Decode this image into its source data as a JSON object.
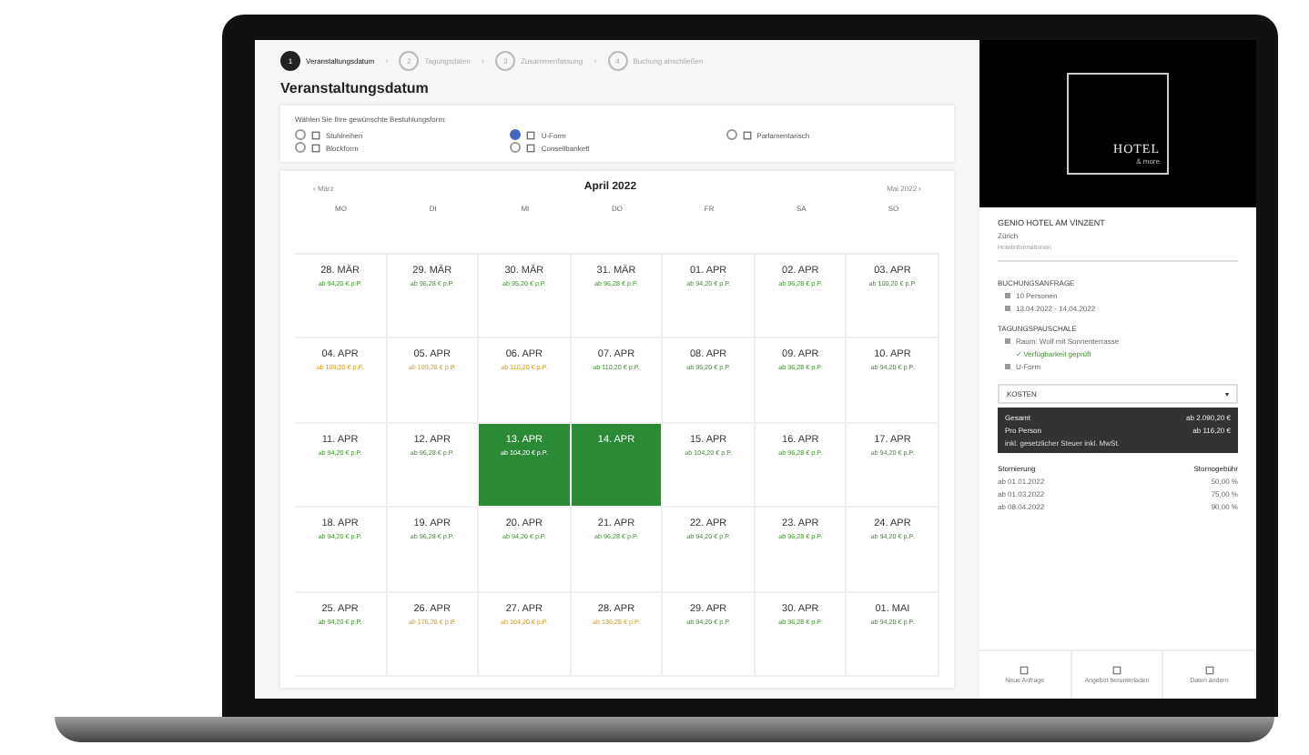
{
  "stepper": {
    "separator": "›",
    "steps": [
      {
        "number": "1",
        "label": "Veranstaltungsdatum",
        "selected": true
      },
      {
        "number": "2",
        "label": "Tagungsdaten",
        "selected": false
      },
      {
        "number": "3",
        "label": "Zusammenfassung",
        "selected": false
      },
      {
        "number": "4",
        "label": "Buchung abschließen",
        "selected": false
      }
    ]
  },
  "page_title": "Veranstaltungsdatum",
  "seating": {
    "prompt": "Wählen Sie Ihre gewünschte Bestuhlungsform:",
    "options": [
      {
        "label": "Stuhlreihen",
        "selected": false
      },
      {
        "label": "U-Form",
        "selected": true
      },
      {
        "label": "Parlamentarisch",
        "selected": false
      },
      {
        "label": "Blockform",
        "selected": false
      },
      {
        "label": "Conseilbankett",
        "selected": false
      }
    ]
  },
  "calendar": {
    "prev": "‹ März",
    "month": "April 2022",
    "next": "Mai 2022 ›",
    "weekdays": [
      "MO",
      "DI",
      "MI",
      "DO",
      "FR",
      "SA",
      "SO"
    ],
    "days": [
      {
        "date": "28. MÄR",
        "price": "ab 94,20 € p.P.",
        "limited": false,
        "selected": false
      },
      {
        "date": "29. MÄR",
        "price": "ab 96,28 € p.P.",
        "limited": false,
        "selected": false
      },
      {
        "date": "30. MÄR",
        "price": "ab 95,20 € p.P.",
        "limited": false,
        "selected": false
      },
      {
        "date": "31. MÄR",
        "price": "ab 96,28 € p.P.",
        "limited": false,
        "selected": false
      },
      {
        "date": "01. APR",
        "price": "ab 94,20 € p.P.",
        "limited": false,
        "selected": false
      },
      {
        "date": "02. APR",
        "price": "ab 96,28 € p.P.",
        "limited": false,
        "selected": false
      },
      {
        "date": "03. APR",
        "price": "ab 100,20 € p.P.",
        "limited": false,
        "selected": false
      },
      {
        "date": "04. APR",
        "price": "ab 109,20 € p.P.",
        "limited": true,
        "selected": false
      },
      {
        "date": "05. APR",
        "price": "ab 109,28 € p.P.",
        "limited": true,
        "selected": false
      },
      {
        "date": "06. APR",
        "price": "ab 110,20 € p.P.",
        "limited": true,
        "selected": false
      },
      {
        "date": "07. APR",
        "price": "ab 110,20 € p.P.",
        "limited": false,
        "selected": false
      },
      {
        "date": "08. APR",
        "price": "ab 95,20 € p.P.",
        "limited": false,
        "selected": false
      },
      {
        "date": "09. APR",
        "price": "ab 96,28 € p.P.",
        "limited": false,
        "selected": false
      },
      {
        "date": "10. APR",
        "price": "ab 94,20 € p.P.",
        "limited": false,
        "selected": false
      },
      {
        "date": "11. APR",
        "price": "ab 94,20 € p.P.",
        "limited": false,
        "selected": false
      },
      {
        "date": "12. APR",
        "price": "ab 96,28 € p.P.",
        "limited": false,
        "selected": false
      },
      {
        "date": "13. APR",
        "price": "ab 104,20 € p.P.",
        "selected": true
      },
      {
        "date": "14. APR",
        "selected": true
      },
      {
        "date": "15. APR",
        "price": "ab 104,20 € p.P.",
        "limited": false,
        "selected": false
      },
      {
        "date": "16. APR",
        "price": "ab 96,28 € p.P.",
        "limited": false,
        "selected": false
      },
      {
        "date": "17. APR",
        "price": "ab 94,20 € p.P.",
        "limited": false,
        "selected": false
      },
      {
        "date": "18. APR",
        "price": "ab 94,20 € p.P.",
        "limited": false,
        "selected": false
      },
      {
        "date": "19. APR",
        "price": "ab 96,28 € p.P.",
        "limited": false,
        "selected": false
      },
      {
        "date": "20. APR",
        "price": "ab 94,20 € p.P.",
        "limited": false,
        "selected": false
      },
      {
        "date": "21. APR",
        "price": "ab 96,28 € p.P.",
        "limited": false,
        "selected": false
      },
      {
        "date": "22. APR",
        "price": "ab 94,20 € p.P.",
        "limited": false,
        "selected": false
      },
      {
        "date": "23. APR",
        "price": "ab 96,28 € p.P.",
        "limited": false,
        "selected": false
      },
      {
        "date": "24. APR",
        "price": "ab 94,20 € p.P.",
        "limited": false,
        "selected": false
      },
      {
        "date": "25. APR",
        "price": "ab 94,20 € p.P.",
        "limited": false,
        "selected": false
      },
      {
        "date": "26. APR",
        "price": "ab 176,28 € p.P.",
        "limited": true,
        "selected": false
      },
      {
        "date": "27. APR",
        "price": "ab 104,20 € p.P.",
        "limited": true,
        "selected": false
      },
      {
        "date": "28. APR",
        "price": "ab 136,28 € p.P.",
        "limited": true,
        "selected": false
      },
      {
        "date": "29. APR",
        "price": "ab 94,20 € p.P.",
        "limited": false,
        "selected": false
      },
      {
        "date": "30. APR",
        "price": "ab 96,28 € p.P.",
        "limited": false,
        "selected": false
      },
      {
        "date": "01. MAI",
        "price": "ab 94,20 € p.P.",
        "limited": false,
        "selected": false
      }
    ]
  },
  "sidebar": {
    "logo": "HOTEL",
    "logo_sub": "& more",
    "hotel_name": "GENIO HOTEL AM VINZENT",
    "city": "Zürich",
    "link": "Hotelinformationen",
    "section_1": "BUCHUNGSANFRAGE",
    "facts_1": [
      "10 Personen",
      "13.04.2022 - 14.04.2022"
    ],
    "section_2": "TAGUNGSPAUSCHALE",
    "facts_2": [
      "Raum: Wolf mit Sonnenterrasse"
    ],
    "confirm": "✓ Verfügbarkeit geprüft",
    "facts_3": [
      "U-Form"
    ],
    "dropdown": "KOSTEN",
    "dropdown_caret": "▾",
    "totals": [
      {
        "label": "Gesamt",
        "value": "ab 2.090,20 €"
      },
      {
        "label": "Pro Person",
        "value": "ab 116,20 €"
      }
    ],
    "totals_note": "inkl. gesetzlicher Steuer inkl. MwSt.",
    "table_head": [
      "Stornierung",
      "Stornogebühr"
    ],
    "table_rows": [
      [
        "ab 01.01.2022",
        "50,00 %"
      ],
      [
        "ab 01.03.2022",
        "75,00 %"
      ],
      [
        "ab 08.04.2022",
        "90,00 %"
      ]
    ],
    "footer": [
      "Neue Anfrage",
      "Angebot herunterladen",
      "Daten ändern"
    ]
  }
}
